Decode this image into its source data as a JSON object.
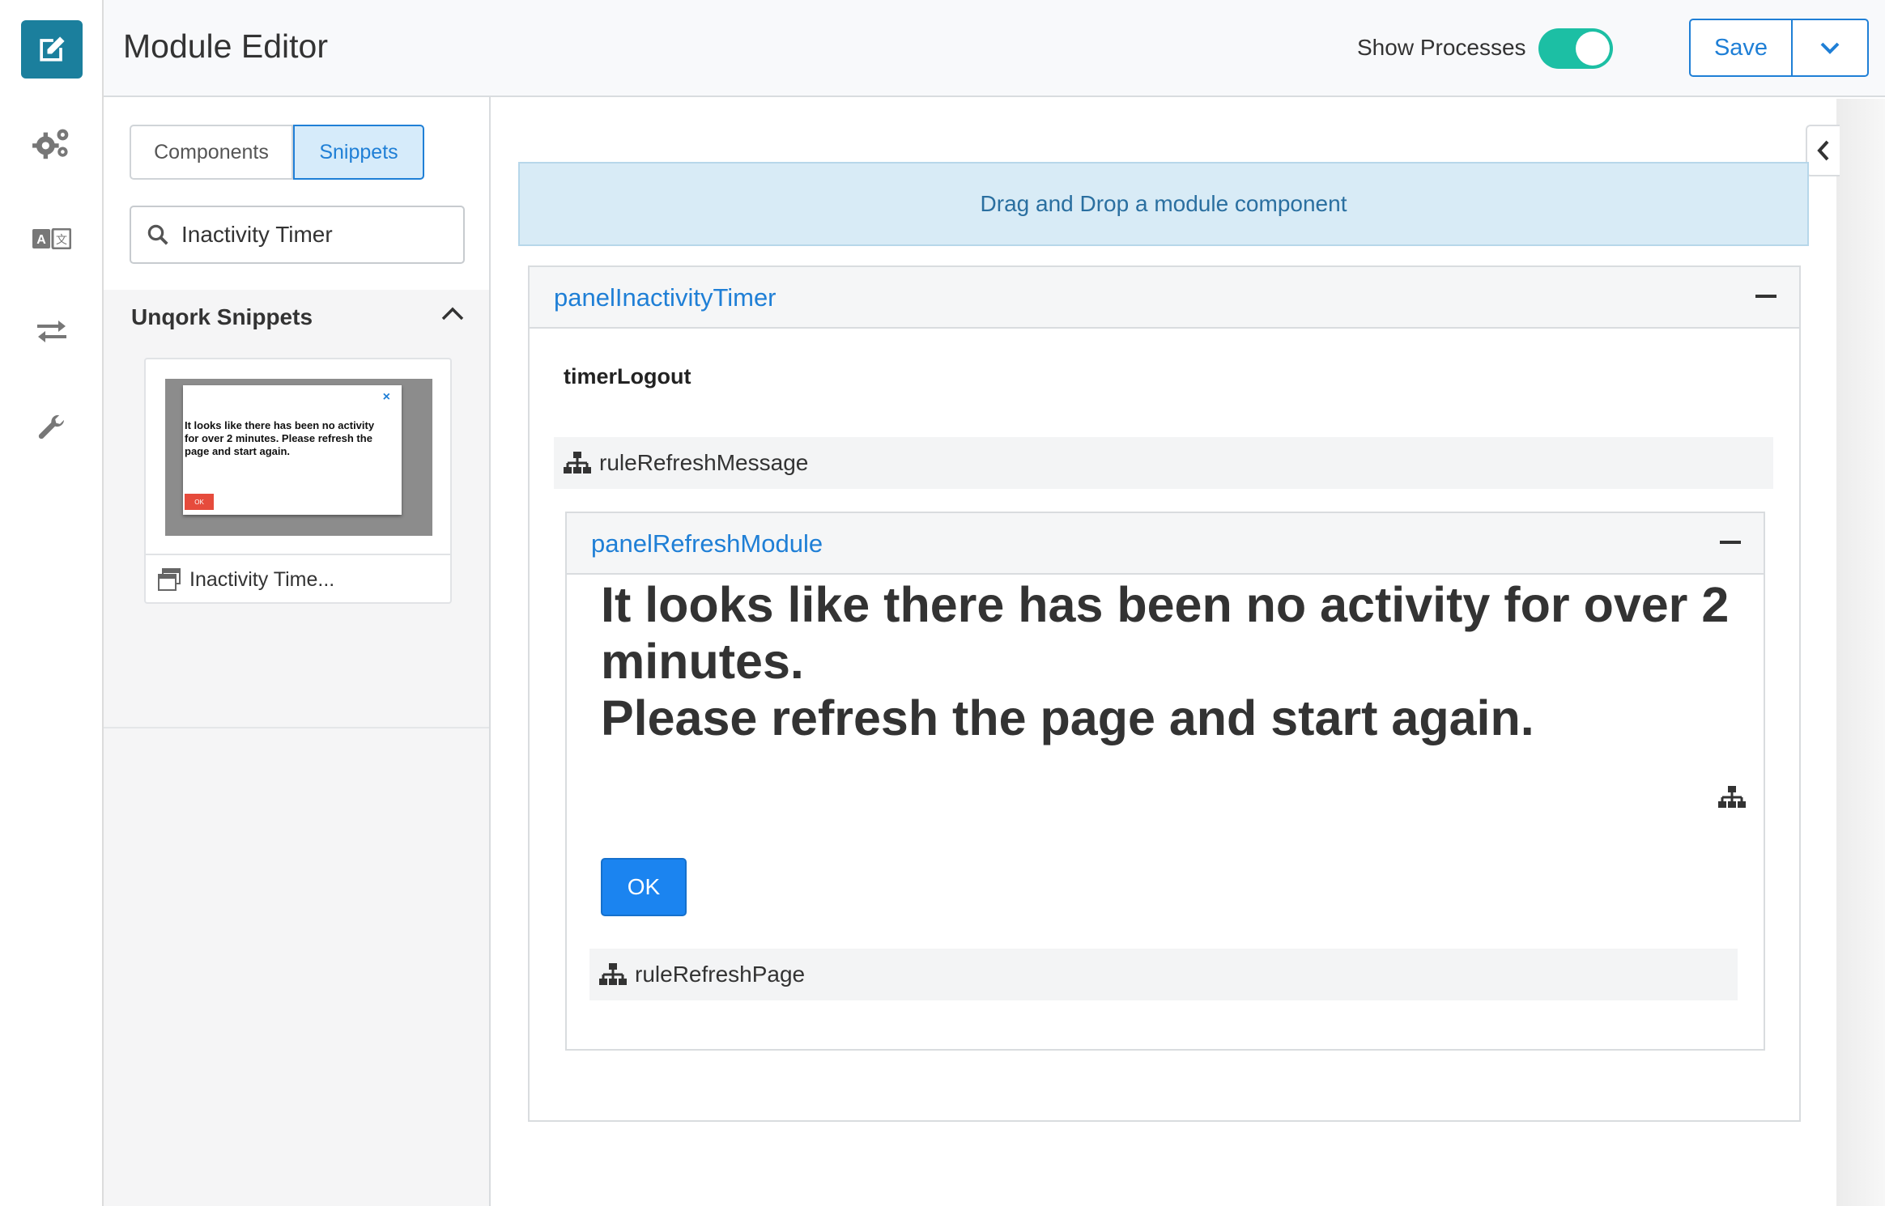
{
  "header": {
    "title": "Module Editor",
    "show_processes_label": "Show Processes",
    "show_processes_on": true,
    "save_label": "Save"
  },
  "rail": {
    "items": [
      {
        "icon": "edit-icon",
        "active": true
      },
      {
        "icon": "gears-icon"
      },
      {
        "icon": "translate-icon"
      },
      {
        "icon": "transfer-arrows-icon"
      },
      {
        "icon": "wrench-icon"
      }
    ]
  },
  "sidebar": {
    "tabs": [
      {
        "label": "Components",
        "selected": false
      },
      {
        "label": "Snippets",
        "selected": true
      }
    ],
    "search": {
      "value": "Inactivity Timer",
      "placeholder": ""
    },
    "section_title": "Unqork Snippets",
    "card": {
      "label": "Inactivity Time...",
      "thumb_close": "×",
      "thumb_text": "It looks like there has been no activity for over 2 minutes. Please refresh the page and start again.",
      "thumb_ok": "OK"
    }
  },
  "canvas": {
    "dropzone": "Drag and Drop a module component",
    "outer_panel": {
      "title": "panelInactivityTimer",
      "timer": "timerLogout",
      "rule": "ruleRefreshMessage"
    },
    "inner_panel": {
      "title": "panelRefreshModule",
      "message_line1": "It looks like there has been no activity for over 2 minutes.",
      "message_line2": "Please refresh the page and start again.",
      "ok_label": "OK",
      "rule": "ruleRefreshPage"
    }
  },
  "colors": {
    "accent": "#1f7fd6",
    "rail_active": "#1b7f9d",
    "toggle_on": "#1cbfa4",
    "dropzone_bg": "#d8ebf6",
    "ok_button": "#1b84f0"
  }
}
